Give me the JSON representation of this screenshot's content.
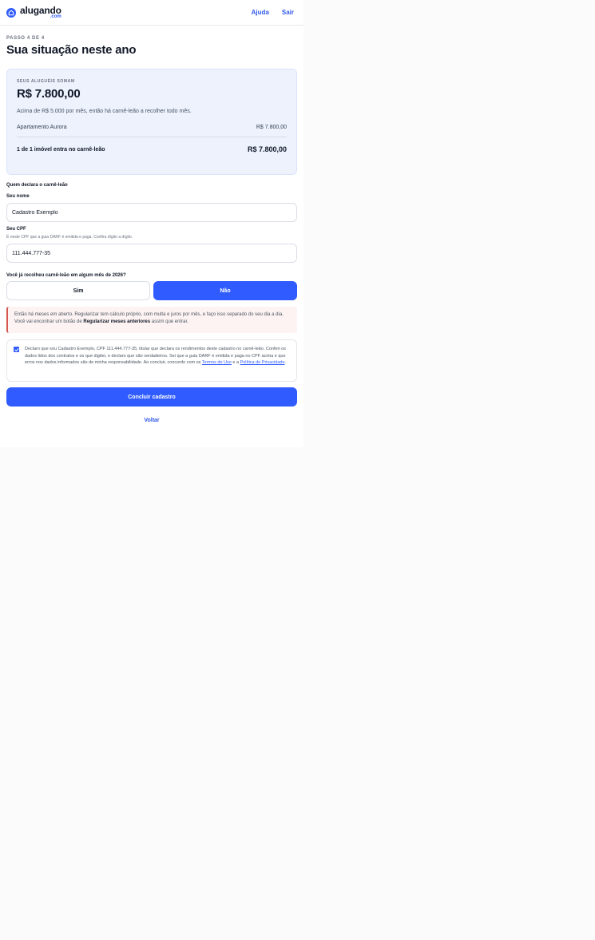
{
  "brand": {
    "name": "alugando",
    "domain": ".com"
  },
  "nav": {
    "help": "Ajuda",
    "logout": "Sair"
  },
  "header": {
    "step": "PASSO 4 DE 4",
    "title": "Sua situação neste ano"
  },
  "summary": {
    "caption": "SEUS ALUGUÉIS SOMAM",
    "total": "R$ 7.800,00",
    "note": "Acima de R$ 5.000 por mês, então há carnê-leão a recolher todo mês.",
    "property_name": "Apartamento Aurora",
    "property_value": "R$ 7.800,00",
    "footer_label": "1 de 1 imóvel entra no carnê-leão",
    "footer_value": "R$ 7.800,00"
  },
  "declarant": {
    "section_title": "Quem declara o carnê-leão",
    "name_label": "Seu nome",
    "name_value": "Cadastro Exemplo",
    "cpf_label": "Seu CPF",
    "cpf_help": "É neste CPF que a guia DARF é emitida e paga. Confira dígito a dígito.",
    "cpf_value": "111.444.777-35"
  },
  "question": {
    "label": "Você já recolheu carnê-leão em algum mês de 2026?",
    "yes": "Sim",
    "no": "Não"
  },
  "warning": {
    "part1": "Então há meses em aberto. Regularizar tem cálculo próprio, com multa e juros por mês, e faço isso separado do seu dia a dia. Você vai encontrar um botão de ",
    "emphasis": "Regularizar meses anteriores",
    "part2": " assim que entrar."
  },
  "declaration": {
    "text": "Declaro que sou Cadastro Exemplo, CPF 111.444.777-35, titular que declara os rendimentos deste cadastro no carnê-leão. Conferi os dados lidos dos contratos e os que digitei, e declaro que são verdadeiros. Sei que a guia DARF é emitida e paga no CPF acima e que erros nos dados informados são de minha responsabilidade. Ao concluir, concordo com os ",
    "terms": "Termos de Uso",
    "joiner": " e a ",
    "privacy": "Política de Privacidade",
    "end": "."
  },
  "actions": {
    "submit": "Concluir cadastro",
    "back": "Voltar"
  },
  "colors": {
    "primary": "#2f5bff",
    "summary_bg": "#edf2fd",
    "warning_bg": "#fdf3f2",
    "warning_border": "#d55650",
    "page_bg": "#fbfbfb"
  }
}
